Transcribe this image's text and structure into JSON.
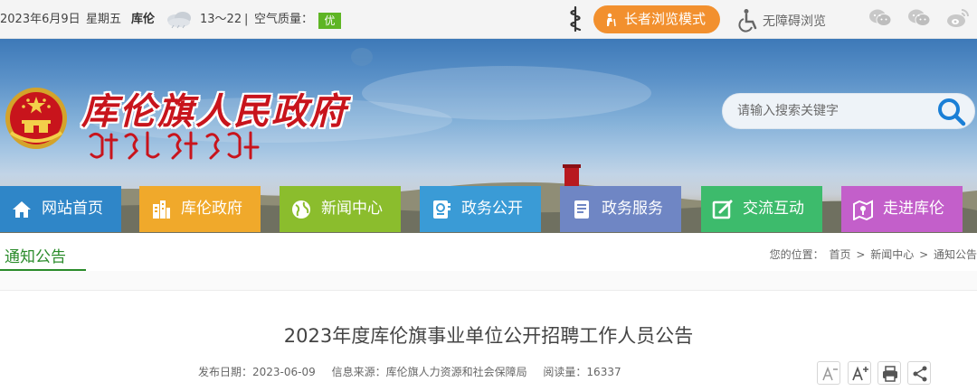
{
  "topbar": {
    "date": "2023年6月9日",
    "weekday": "星期五",
    "city": "库伦",
    "temperature": "13～22",
    "separator": "|",
    "aqi_label": "空气质量：",
    "aqi_value": "优",
    "elder_mode": "长者浏览模式",
    "accessible": "无障碍浏览",
    "icons": [
      "mongolian-script-icon",
      "wechat-icon",
      "mini-program-icon",
      "weibo-icon"
    ]
  },
  "header": {
    "site_title": "库伦旗人民政府",
    "search_placeholder": "请输入搜索关键字"
  },
  "nav": [
    {
      "label": "网站首页",
      "icon": "home-icon",
      "color": "#2f86c8"
    },
    {
      "label": "库伦政府",
      "icon": "buildings-icon",
      "color": "#f0a92b"
    },
    {
      "label": "新闻中心",
      "icon": "globe-icon",
      "color": "#8bbd2d"
    },
    {
      "label": "政务公开",
      "icon": "document-icon",
      "color": "#3a9bd6"
    },
    {
      "label": "政务服务",
      "icon": "book-icon",
      "color": "#6f86c4"
    },
    {
      "label": "交流互动",
      "icon": "edit-icon",
      "color": "#3dbb6c"
    },
    {
      "label": "走进库伦",
      "icon": "map-icon",
      "color": "#c35fca"
    }
  ],
  "section": {
    "title": "通知公告",
    "crumb_prefix": "您的位置：",
    "crumbs": [
      "首页",
      "新闻中心",
      "通知公告"
    ],
    "crumb_sep": ">"
  },
  "article": {
    "title": "2023年度库伦旗事业单位公开招聘工作人员公告",
    "publish_date": "发布日期：2023-06-09",
    "source": "信息来源：库伦旗人力资源和社会保障局",
    "views": "阅读量：16337",
    "tools": [
      "font-decrease-icon",
      "font-increase-icon",
      "print-icon",
      "share-icon"
    ]
  }
}
